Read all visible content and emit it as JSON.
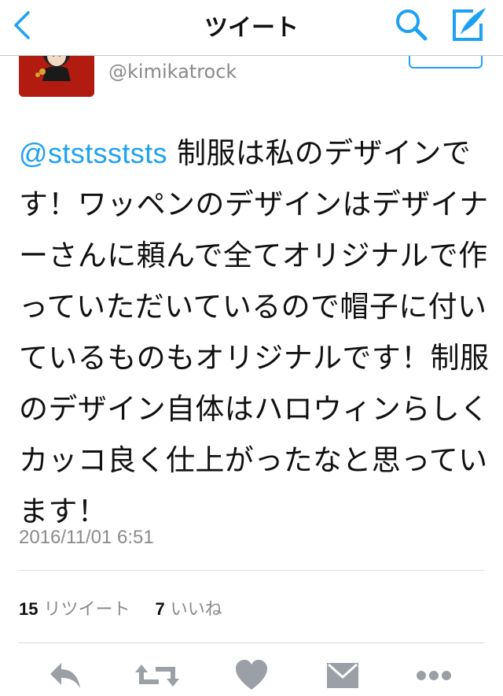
{
  "nav": {
    "title": "ツイート"
  },
  "user": {
    "handle": "@kimikatrock"
  },
  "tweet": {
    "mention": "@ststsststs",
    "body": " 制服は私のデザインです！ワッペンのデザインはデザイナーさんに頼んで全てオリジナルで作っていただいているので帽子に付いているものもオリジナルです！制服のデザイン自体はハロウィンらしくカッコ良く仕上がったなと思っています！",
    "timestamp": "2016/11/01 6:51"
  },
  "stats": {
    "retweet_count": "15",
    "retweet_label": "リツイート",
    "like_count": "7",
    "like_label": "いいね"
  },
  "icons": {
    "back": "chevron-left-icon",
    "search": "search-icon",
    "compose": "compose-icon",
    "reply": "reply-icon",
    "retweet": "retweet-icon",
    "like": "heart-icon",
    "dm": "envelope-icon",
    "more": "more-icon"
  },
  "colors": {
    "accent": "#1da1f2",
    "action_gray": "#9aa0a6",
    "avatar_bg": "#b21b10"
  }
}
